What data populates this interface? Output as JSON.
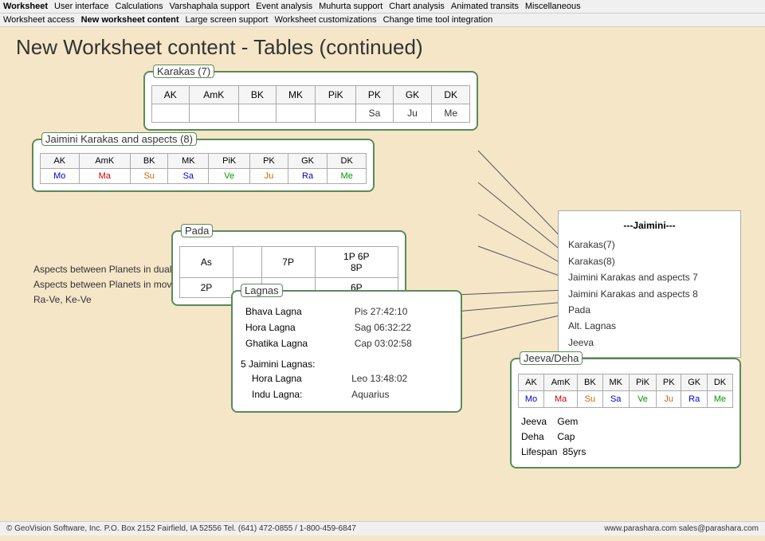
{
  "menuBar": {
    "items": [
      {
        "label": "Worksheet",
        "bold": true
      },
      {
        "label": "User interface"
      },
      {
        "label": "Calculations"
      },
      {
        "label": "Varshaphala support"
      },
      {
        "label": "Event analysis"
      },
      {
        "label": "Muhurta support"
      },
      {
        "label": "Chart analysis"
      },
      {
        "label": "Animated transits"
      },
      {
        "label": "Miscellaneous"
      }
    ]
  },
  "subMenuBar": {
    "items": [
      {
        "label": "Worksheet access"
      },
      {
        "label": "New worksheet content",
        "active": true
      },
      {
        "label": "Large screen support"
      },
      {
        "label": "Worksheet customizations"
      },
      {
        "label": "Change time tool integration"
      }
    ]
  },
  "pageTitle": "New Worksheet content - Tables (continued)",
  "karakas": {
    "title": "Karakas (7)",
    "headers": [
      "AK",
      "AmK",
      "BK",
      "MK",
      "PiK",
      "PK",
      "GK",
      "DK"
    ],
    "values": [
      "Sa",
      "Ju",
      "Me",
      "",
      "",
      "",
      "",
      ""
    ]
  },
  "jaimini": {
    "title": "Jaimini Karakas and aspects (8)",
    "headers": [
      "AK",
      "AmK",
      "BK",
      "MK",
      "PiK",
      "PK",
      "GK",
      "DK"
    ],
    "values": [
      "Mo",
      "Ma",
      "Su",
      "Sa",
      "Ve",
      "Ju",
      "Ra",
      "Me"
    ]
  },
  "aspects": {
    "line1": "Aspects between Planets in dual signs: Mo-Ma-Ju-Sa",
    "line2": "Aspects between Planets in movable and fixed signs:",
    "line3": "Ra-Ve, Ke-Ve"
  },
  "pada": {
    "title": "Pada",
    "headers": [
      "As",
      "",
      "7P",
      "1P 6P\n8P"
    ],
    "row2": [
      "2P",
      "",
      "",
      "6P"
    ]
  },
  "lagnas": {
    "title": "Lagnas",
    "rows": [
      {
        "name": "Bhava Lagna",
        "value": "Pis 27:42:10"
      },
      {
        "name": "Hora Lagna",
        "value": "Sag 06:32:22"
      },
      {
        "name": "Ghatika Lagna",
        "value": "Cap 03:02:58"
      }
    ],
    "jaiminiTitle": "Jaimini Lagnas:",
    "jaiminiRows": [
      {
        "name": "Hora Lagna",
        "value": "Leo 13:48:02"
      },
      {
        "name": "Indu Lagna:",
        "value": "Aquarius"
      }
    ],
    "prefix": "5"
  },
  "rightList": {
    "title": "---Jaimini---",
    "items": [
      "Karakas(7)",
      "Karakas(8)",
      "Jaimini Karakas and aspects 7",
      "Jaimini Karakas and aspects 8",
      "Pada",
      "Alt. Lagnas",
      "Jeeva"
    ]
  },
  "jeeva": {
    "title": "Jeeva/Deha",
    "headers": [
      "AK",
      "AmK",
      "BK",
      "MK",
      "PiK",
      "PK",
      "GK",
      "DK"
    ],
    "values": [
      "Mo",
      "Ma",
      "Su",
      "Sa",
      "Ve",
      "Ju",
      "Ra",
      "Me"
    ],
    "info": [
      {
        "label": "Jeeva",
        "value": "Gem"
      },
      {
        "label": "Deha",
        "value": "Cap"
      },
      {
        "label": "Lifespan",
        "value": "85yrs"
      }
    ]
  },
  "footer": {
    "left": "© GeoVision Software, Inc. P.O. Box 2152 Fairfield, IA 52556    Tel. (641) 472-0855 / 1-800-459-6847",
    "right": "www.parashara.com    sales@parashara.com"
  }
}
